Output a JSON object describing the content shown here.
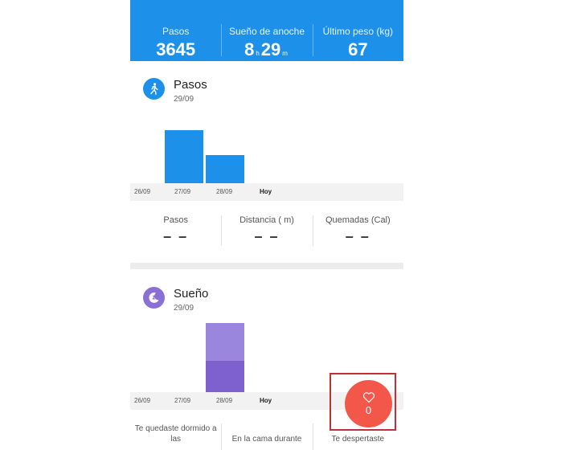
{
  "header": {
    "steps_label": "Pasos",
    "steps_value": "3645",
    "sleep_label": "Sueño de anoche",
    "sleep_hours": "8",
    "sleep_hours_unit": "h",
    "sleep_minutes": "29",
    "sleep_minutes_unit": "m",
    "weight_label": "Último peso (kg)",
    "weight_value": "67",
    "accent": "#1d91ea"
  },
  "steps_section": {
    "title": "Pasos",
    "date": "29/09",
    "icon": "walking-icon",
    "color": "#1d91ea",
    "chart_data": {
      "type": "bar",
      "categories": [
        "26/09",
        "27/09",
        "28/09",
        "Hoy"
      ],
      "values": [
        0,
        66,
        35,
        0
      ]
    },
    "metrics": [
      {
        "label": "Pasos",
        "value": "– –"
      },
      {
        "label": "Distancia ( m)",
        "value": "– –"
      },
      {
        "label": "Quemadas (Cal)",
        "value": "– –"
      }
    ]
  },
  "sleep_section": {
    "title": "Sueño",
    "date": "29/09",
    "icon": "moon-sleep-icon",
    "color": "#8a6fd6",
    "chart_data": {
      "type": "bar",
      "categories": [
        "26/09",
        "27/09",
        "28/09",
        "Hoy"
      ],
      "stacked": true,
      "series": [
        {
          "values": [
            0,
            0,
            39,
            0
          ],
          "color": "#7e61cf"
        },
        {
          "values": [
            0,
            0,
            47,
            0
          ],
          "color": "#9a86dc"
        }
      ]
    },
    "details": [
      {
        "label": "Te quedaste dormido a las"
      },
      {
        "label": "En la cama durante"
      },
      {
        "label": "Te despertaste"
      }
    ]
  },
  "heart_rate": {
    "icon": "heart-icon",
    "count": "0",
    "color": "#f2574a"
  }
}
